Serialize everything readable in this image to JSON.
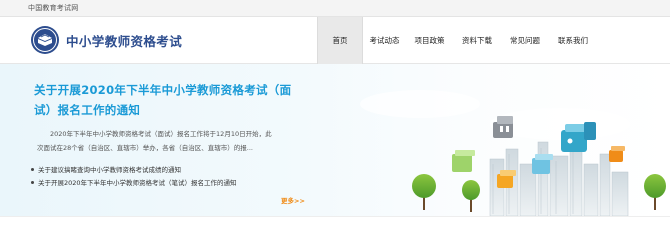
{
  "topbar": {
    "site_name": "中国教育考试网"
  },
  "header": {
    "brand_title": "中小学教师资格考试",
    "logo_icon": "book-emblem-icon",
    "brand_color": "#2d4d8e"
  },
  "nav": {
    "items": [
      {
        "label": "首页",
        "active": true
      },
      {
        "label": "考试动态",
        "active": false
      },
      {
        "label": "项目政策",
        "active": false
      },
      {
        "label": "资料下载",
        "active": false
      },
      {
        "label": "常见问题",
        "active": false
      },
      {
        "label": "联系我们",
        "active": false
      }
    ]
  },
  "banner": {
    "headline": "关于开展2020年下半年中小学教师资格考试（面试）报名工作的通知",
    "summary": "2020年下半年中小学教师资格考试（面试）报名工作将于12月10日开始，此次面试在28个省（自治区、直辖市）举办，各省（自治区、直辖市）的报...",
    "links": [
      "关于建议搞睹查询中小学教师资格考试成绩的通知",
      "关于开展2020年下半年中小学教师资格考试（笔试）报名工作的通知"
    ],
    "more_label": "更多>>",
    "headline_color": "#1a9ad6",
    "more_color": "#f08c18"
  }
}
